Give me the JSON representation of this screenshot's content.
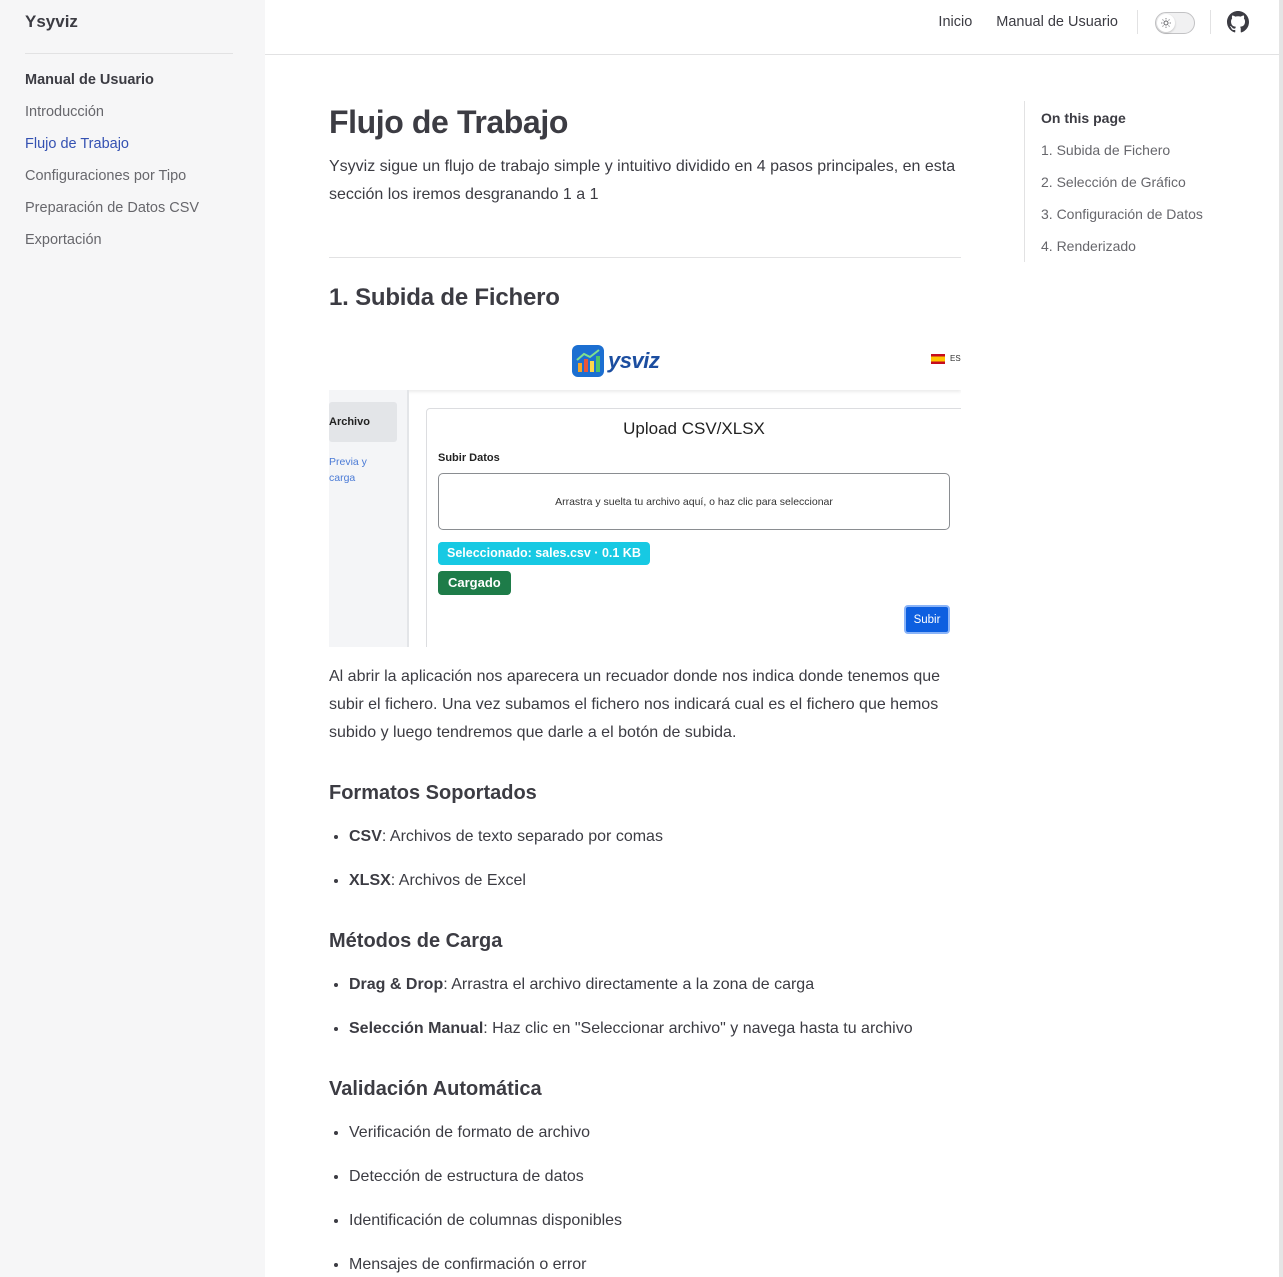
{
  "sidebar": {
    "brand": "Ysyviz",
    "group_title": "Manual de Usuario",
    "items": [
      {
        "label": "Introducción"
      },
      {
        "label": "Flujo de Trabajo"
      },
      {
        "label": "Configuraciones por Tipo"
      },
      {
        "label": "Preparación de Datos CSV"
      },
      {
        "label": "Exportación"
      }
    ],
    "active_index": 1
  },
  "topnav": {
    "links": [
      "Inicio",
      "Manual de Usuario"
    ],
    "theme_toggle_icon": "sun-icon",
    "github_icon": "github-icon"
  },
  "page": {
    "title": "Flujo de Trabajo",
    "lead": "Ysyviz sigue un flujo de trabajo simple y intuitivo dividido en 4 pasos principales, en esta sección los iremos desgranando 1 a 1",
    "section1": {
      "title": "1. Subida de Fichero",
      "description": "Al abrir la aplicación nos aparecera un recuador donde nos indica donde tenemos que subir el fichero. Una vez subamos el fichero nos indicará cual es el fichero que hemos subido y luego tendremos que darle a el botón de subida."
    },
    "formats": {
      "title": "Formatos Soportados",
      "items": [
        {
          "term": "CSV",
          "text": ": Archivos de texto separado por comas"
        },
        {
          "term": "XLSX",
          "text": ": Archivos de Excel"
        }
      ]
    },
    "methods": {
      "title": "Métodos de Carga",
      "items": [
        {
          "term": "Drag & Drop",
          "text": ": Arrastra el archivo directamente a la zona de carga"
        },
        {
          "term": "Selección Manual",
          "text": ": Haz clic en \"Seleccionar archivo\" y navega hasta tu archivo"
        }
      ]
    },
    "validation": {
      "title": "Validación Automática",
      "items": [
        "Verificación de formato de archivo",
        "Detección de estructura de datos",
        "Identificación de columnas disponibles",
        "Mensajes de confirmación o error"
      ]
    }
  },
  "screenshot": {
    "logo_text": "ysviz",
    "lang": "ES",
    "side_active": "Archivo",
    "side_link": "Previa y carga",
    "card_title": "Upload CSV/XLSX",
    "field_label": "Subir Datos",
    "dropzone_text": "Arrastra y suelta tu archivo aquí, o haz clic para seleccionar",
    "selected_badge": "Seleccionado: sales.csv · 0.1 KB",
    "loaded_badge": "Cargado",
    "submit_label": "Subir",
    "colors": {
      "badge_selected": "#17c9e3",
      "badge_loaded": "#1e7c49",
      "button": "#0d5fe0"
    }
  },
  "toc": {
    "title": "On this page",
    "items": [
      "1. Subida de Fichero",
      "2. Selección de Gráfico",
      "3. Configuración de Datos",
      "4. Renderizado"
    ]
  },
  "colors": {
    "accent": "#3451b2",
    "text": "#3c3c43",
    "muted": "#67676c",
    "sidebar_bg": "#f6f6f7"
  }
}
